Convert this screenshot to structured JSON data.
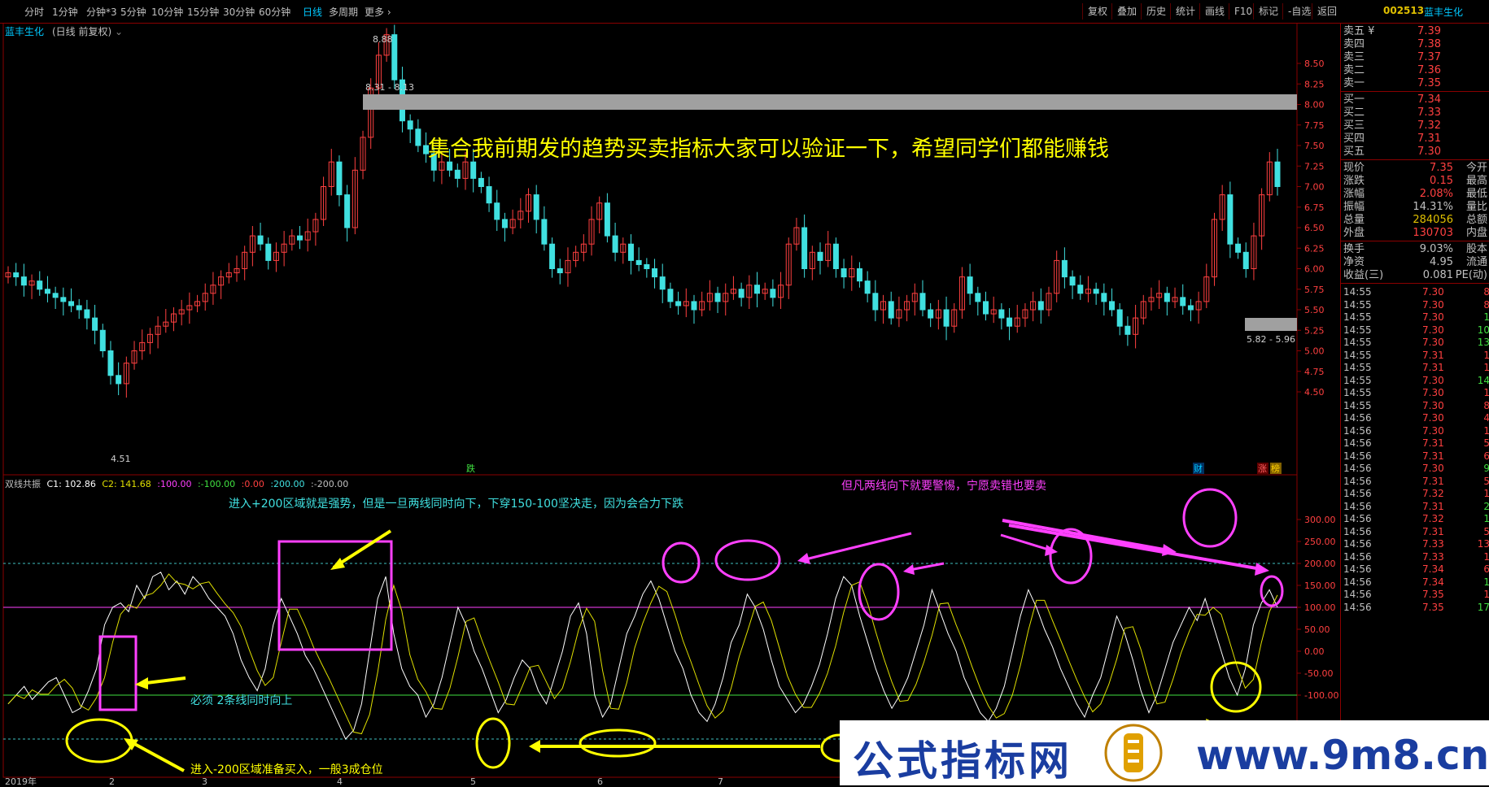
{
  "toolbar": {
    "periods": [
      "分时",
      "1分钟",
      "分钟*3",
      "5分钟",
      "10分钟",
      "15分钟",
      "30分钟",
      "60分钟",
      "日线",
      "多周期",
      "更多"
    ],
    "active_period": "日线",
    "right_buttons": [
      "复权",
      "叠加",
      "历史",
      "统计",
      "画线",
      "F10",
      "标记",
      "-自选",
      "返回"
    ],
    "stock_code": "002513",
    "stock_name": "蓝丰生化"
  },
  "main_chart": {
    "title": "蓝丰生化",
    "subtitle": "(日线 前复权)",
    "price_labels": [
      "8.50",
      "8.25",
      "8.00",
      "7.75",
      "7.50",
      "7.25",
      "7.00",
      "6.75",
      "6.50",
      "6.25",
      "6.00",
      "5.75",
      "5.50",
      "5.25",
      "5.00",
      "4.75",
      "4.50"
    ],
    "high_label": "8.88",
    "low_label": "4.51",
    "zone_top_label": "8.31 - 8.13",
    "zone_bottom_label": "5.82 - 5.96",
    "headline": "集合我前期发的趋势买卖指标大家可以验证一下，希望同学们都能赚钱",
    "event_marks": [
      "跌",
      "财",
      "涨",
      "榜"
    ]
  },
  "indicator": {
    "name": "双线共振",
    "c1_label": "C1: 102.86",
    "c2_label": "C2: 141.68",
    "refs": [
      ":100.00",
      ":-100.00",
      ":0.00",
      ":200.00",
      ":-200.00"
    ],
    "axis_labels": [
      "300.00",
      "250.00",
      "200.00",
      "150.00",
      "100.00",
      "50.00",
      "0.00",
      "-50.00",
      "-100.00"
    ],
    "annotations": {
      "top_left": "进入+200区域就是强势，但是一旦两线同时向下，下穿150-100坚决走，因为会合力下跌",
      "top_right": "但凡两线向下就要警惕，宁愿卖错也要卖",
      "middle_left": "必须 2条线同时向上",
      "bottom_left": "进入-200区域准备买入，一般3成仓位"
    }
  },
  "x_axis": [
    "2019年",
    "2",
    "3",
    "4",
    "5",
    "6",
    "7"
  ],
  "quote_panel": {
    "asks": [
      {
        "label": "卖五",
        "flag": "¥",
        "price": "7.39"
      },
      {
        "label": "卖四",
        "flag": "",
        "price": "7.38"
      },
      {
        "label": "卖三",
        "flag": "",
        "price": "7.37"
      },
      {
        "label": "卖二",
        "flag": "",
        "price": "7.36"
      },
      {
        "label": "卖一",
        "flag": "",
        "price": "7.35"
      }
    ],
    "bids": [
      {
        "label": "买一",
        "price": "7.34"
      },
      {
        "label": "买二",
        "price": "7.33"
      },
      {
        "label": "买三",
        "price": "7.32"
      },
      {
        "label": "买四",
        "price": "7.31"
      },
      {
        "label": "买五",
        "price": "7.30"
      }
    ],
    "stats": [
      {
        "label": "现价",
        "value": "7.35",
        "label2": "今开",
        "color": "#ff4040"
      },
      {
        "label": "涨跌",
        "value": "0.15",
        "label2": "最高",
        "color": "#ff4040"
      },
      {
        "label": "涨幅",
        "value": "2.08%",
        "label2": "最低",
        "color": "#ff4040"
      },
      {
        "label": "振幅",
        "value": "14.31%",
        "label2": "量比",
        "color": "#c0c0c0"
      },
      {
        "label": "总量",
        "value": "284056",
        "label2": "总额",
        "color": "#e0c000"
      },
      {
        "label": "外盘",
        "value": "130703",
        "label2": "内盘",
        "color": "#ff4040"
      }
    ],
    "stats2": [
      {
        "label": "换手",
        "value": "9.03%",
        "label2": "股本"
      },
      {
        "label": "净资",
        "value": "4.95",
        "label2": "流通"
      },
      {
        "label": "收益(三)",
        "value": "0.081",
        "label2": "PE(动)"
      }
    ],
    "ticks": [
      {
        "time": "14:55",
        "price": "7.30",
        "vol": "8",
        "c": "r"
      },
      {
        "time": "14:55",
        "price": "7.30",
        "vol": "8",
        "c": "r"
      },
      {
        "time": "14:55",
        "price": "7.30",
        "vol": "1",
        "c": "g"
      },
      {
        "time": "14:55",
        "price": "7.30",
        "vol": "10",
        "c": "g"
      },
      {
        "time": "14:55",
        "price": "7.30",
        "vol": "13",
        "c": "g"
      },
      {
        "time": "14:55",
        "price": "7.31",
        "vol": "1",
        "c": "r"
      },
      {
        "time": "14:55",
        "price": "7.31",
        "vol": "1",
        "c": "r"
      },
      {
        "time": "14:55",
        "price": "7.30",
        "vol": "14",
        "c": "g"
      },
      {
        "time": "14:55",
        "price": "7.30",
        "vol": "1",
        "c": "r"
      },
      {
        "time": "14:55",
        "price": "7.30",
        "vol": "8",
        "c": "r"
      },
      {
        "time": "14:56",
        "price": "7.30",
        "vol": "4",
        "c": "r"
      },
      {
        "time": "14:56",
        "price": "7.30",
        "vol": "1",
        "c": "r"
      },
      {
        "time": "14:56",
        "price": "7.31",
        "vol": "5",
        "c": "r"
      },
      {
        "time": "14:56",
        "price": "7.31",
        "vol": "6",
        "c": "r"
      },
      {
        "time": "14:56",
        "price": "7.30",
        "vol": "9",
        "c": "g"
      },
      {
        "time": "14:56",
        "price": "7.31",
        "vol": "5",
        "c": "r"
      },
      {
        "time": "14:56",
        "price": "7.32",
        "vol": "1",
        "c": "r"
      },
      {
        "time": "14:56",
        "price": "7.31",
        "vol": "2",
        "c": "g"
      },
      {
        "time": "14:56",
        "price": "7.32",
        "vol": "1",
        "c": "g"
      },
      {
        "time": "14:56",
        "price": "7.31",
        "vol": "5",
        "c": "r"
      },
      {
        "time": "14:56",
        "price": "7.33",
        "vol": "13",
        "c": "r"
      },
      {
        "time": "14:56",
        "price": "7.33",
        "vol": "1",
        "c": "r"
      },
      {
        "time": "14:56",
        "price": "7.34",
        "vol": "6",
        "c": "r"
      },
      {
        "time": "14:56",
        "price": "7.34",
        "vol": "1",
        "c": "g"
      },
      {
        "time": "14:56",
        "price": "7.35",
        "vol": "1",
        "c": "r"
      },
      {
        "time": "14:56",
        "price": "7.35",
        "vol": "17",
        "c": "g"
      }
    ]
  },
  "watermark": {
    "text1": "公式指标网",
    "text2": "www.9m8.cn"
  },
  "colors": {
    "up": "#ff4040",
    "down": "#40e0e0",
    "accent": "#00c8ff",
    "annotation_yellow": "#ffff00",
    "annotation_magenta": "#ff40ff",
    "line_c1": "#ffffff",
    "line_c2": "#e0e000"
  }
}
